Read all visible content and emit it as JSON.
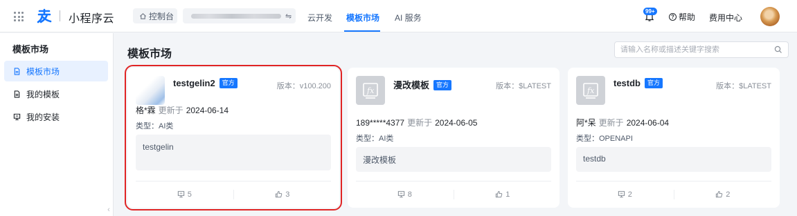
{
  "header": {
    "brand_name": "小程序云",
    "console_label": "控制台",
    "nav": [
      "云开发",
      "模板市场",
      "AI 服务"
    ],
    "active_nav": "模板市场",
    "notification_badge": "99+",
    "help_label": "帮助",
    "cost_center_label": "费用中心"
  },
  "sidebar": {
    "title": "模板市场",
    "items": [
      {
        "label": "模板市场",
        "icon": "file-icon",
        "active": true
      },
      {
        "label": "我的模板",
        "icon": "file-icon",
        "active": false
      },
      {
        "label": "我的安装",
        "icon": "monitor-icon",
        "active": false
      }
    ]
  },
  "main": {
    "title": "模板市场",
    "search": {
      "placeholder": "请输入名称或描述关键字搜索"
    }
  },
  "cards": [
    {
      "name": "testgelin2",
      "tag": "官方",
      "version": "版本：v100.200",
      "author": "格*霖",
      "updated_label": "更新于",
      "date": "2024-06-14",
      "type": "类型：AI类",
      "description": "testgelin",
      "installs": "5",
      "likes": "3"
    },
    {
      "name": "漫改模板",
      "tag": "官方",
      "version": "版本：$LATEST",
      "author": "189*****4377",
      "updated_label": "更新于",
      "date": "2024-06-05",
      "type": "类型：AI类",
      "description": "漫改模板",
      "installs": "8",
      "likes": "1"
    },
    {
      "name": "testdb",
      "tag": "官方",
      "version": "版本：$LATEST",
      "author": "阿*呆",
      "updated_label": "更新于",
      "date": "2024-06-04",
      "type": "类型：OPENAPI",
      "description": "testdb",
      "installs": "2",
      "likes": "2"
    }
  ],
  "colors": {
    "accent": "#1677ff",
    "selection_outline": "#e02424",
    "background": "#f3f5f8"
  }
}
